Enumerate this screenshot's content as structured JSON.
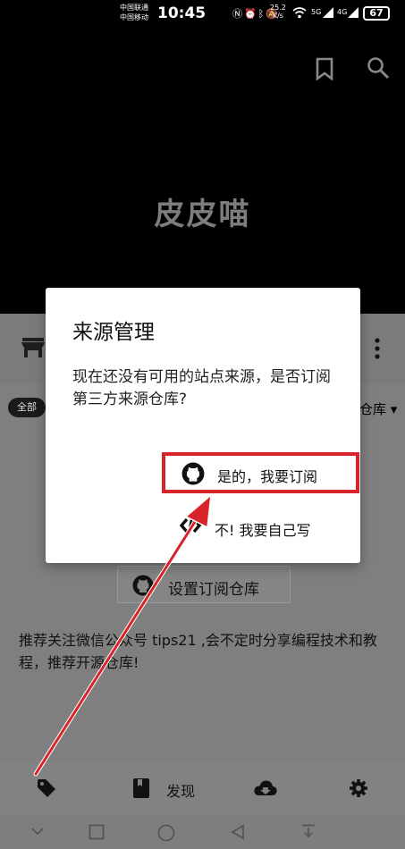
{
  "status_bar": {
    "carrier_1": "中国联通",
    "carrier_2": "中国移动",
    "time": "10:45",
    "speed_value": "25.2",
    "speed_unit": "K/s",
    "net_1": "5G",
    "net_2": "4G",
    "battery": "67"
  },
  "header": {
    "title": "皮皮喵"
  },
  "content": {
    "filter_chip": "全部",
    "repo_dropdown": "仓库 ▾",
    "setup_button": "设置订阅仓库",
    "recommend_text": "推荐关注微信公众号 tips21 ,会不定时分享编程技术和教程，推荐开源仓库!"
  },
  "dialog": {
    "title": "来源管理",
    "message": "现在还没有可用的站点来源，是否订阅第三方来源仓库?",
    "confirm_label": "是的，我要订阅",
    "decline_label": "不!  我要自己写"
  },
  "bottom_nav": {
    "discover_label": "发现"
  },
  "colors": {
    "highlight": "#d8232a",
    "header_bg": "#000000",
    "overlay": "#7f7f7f"
  }
}
